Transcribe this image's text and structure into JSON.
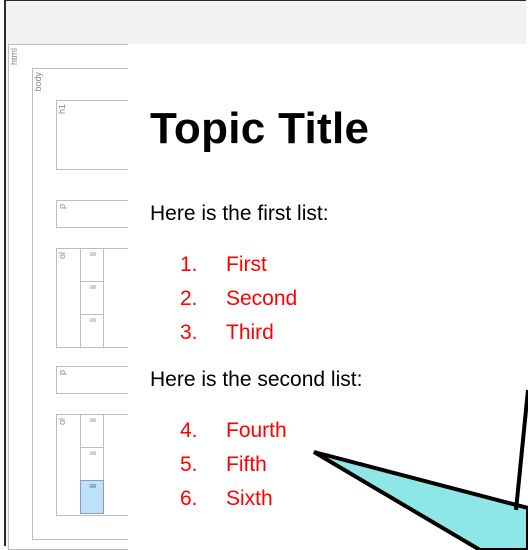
{
  "structure_tags": {
    "html": "html",
    "body": "body",
    "h1": "h1",
    "p1": "p",
    "ol1": "ol",
    "p2": "p",
    "ol2": "ol",
    "li": "li"
  },
  "document": {
    "title": "Topic Title",
    "intro_1": "Here is the first list:",
    "list_1": [
      {
        "num": "1.",
        "text": "First"
      },
      {
        "num": "2.",
        "text": "Second"
      },
      {
        "num": "3.",
        "text": "Third"
      }
    ],
    "intro_2": "Here is the second list:",
    "list_2": [
      {
        "num": "4.",
        "text": "Fourth"
      },
      {
        "num": "5.",
        "text": "Fifth"
      },
      {
        "num": "6.",
        "text": "Sixth"
      }
    ]
  },
  "colors": {
    "list_text": "#ff0000",
    "selected_tag": "#bfe0fb",
    "callout_fill": "#8fe6e6"
  }
}
